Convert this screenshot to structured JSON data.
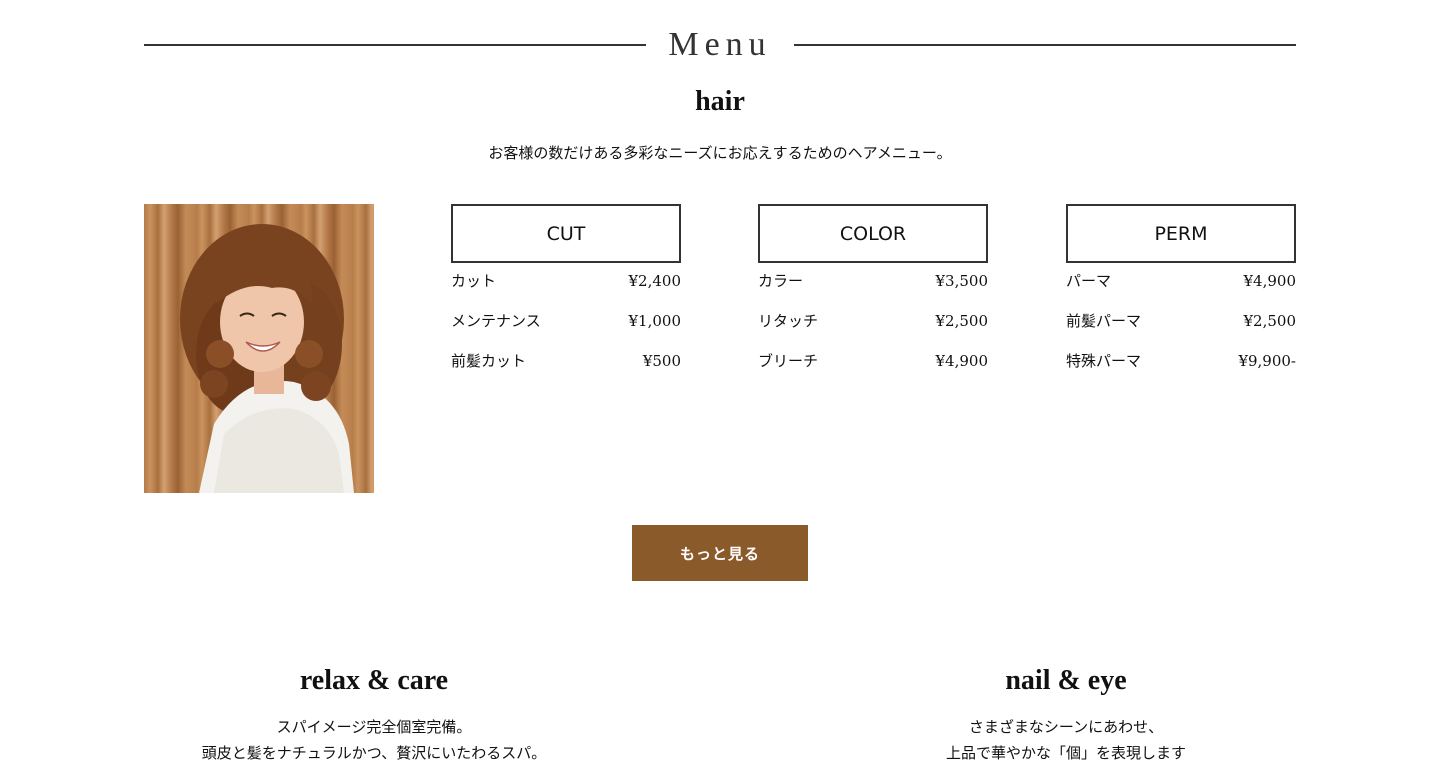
{
  "menu": {
    "title": "Menu"
  },
  "hair": {
    "title": "hair",
    "description": "お客様の数だけある多彩なニーズにお応えするためのヘアメニュー。",
    "categories": [
      {
        "label": "CUT",
        "items": [
          {
            "name": "カット",
            "price": "¥2,400"
          },
          {
            "name": "メンテナンス",
            "price": "¥1,000"
          },
          {
            "name": "前髪カット",
            "price": "¥500"
          }
        ]
      },
      {
        "label": "COLOR",
        "items": [
          {
            "name": "カラー",
            "price": "¥3,500"
          },
          {
            "name": "リタッチ",
            "price": "¥2,500"
          },
          {
            "name": "ブリーチ",
            "price": "¥4,900"
          }
        ]
      },
      {
        "label": "PERM",
        "items": [
          {
            "name": "パーマ",
            "price": "¥4,900"
          },
          {
            "name": "前髪パーマ",
            "price": "¥2,500"
          },
          {
            "name": "特殊パーマ",
            "price": "¥9,900-"
          }
        ]
      }
    ],
    "more_label": "もっと見る"
  },
  "relax": {
    "title": "relax & care",
    "line1": "スパイメージ完全個室完備。",
    "line2": "頭皮と髪をナチュラルかつ、贅沢にいたわるスパ。"
  },
  "nail": {
    "title": "nail & eye",
    "line1": "さまざまなシーンにあわせ、",
    "line2": "上品で華やかな「個」を表現します"
  },
  "colors": {
    "accent": "#8b5a2b",
    "rule": "#333333",
    "text": "#111111"
  }
}
